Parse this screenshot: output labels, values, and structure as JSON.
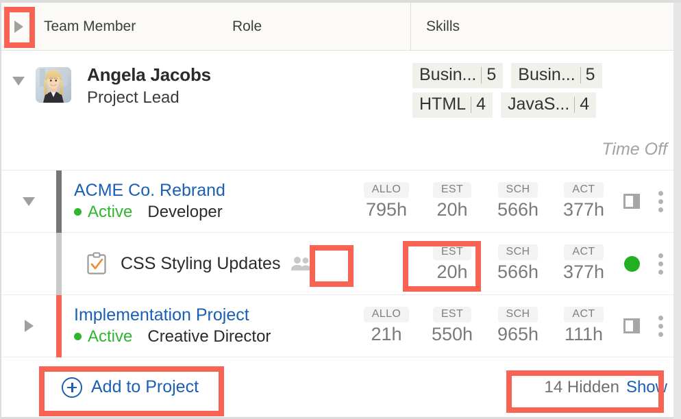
{
  "header": {
    "expand_icon": "caret-right-icon",
    "columns": [
      {
        "label": "Team Member"
      },
      {
        "label": "Role"
      },
      {
        "label": "Skills"
      }
    ]
  },
  "member": {
    "collapse_icon": "caret-down-icon",
    "avatar_alt": "Angela Jacobs avatar",
    "name": "Angela Jacobs",
    "role": "Project Lead",
    "skills": [
      {
        "name": "Busin...",
        "level": "5"
      },
      {
        "name": "Busin...",
        "level": "5"
      },
      {
        "name": "HTML",
        "level": "4"
      },
      {
        "name": "JavaS...",
        "level": "4"
      }
    ],
    "time_off_label": "Time Off"
  },
  "rows": [
    {
      "kind": "project",
      "caret": "caret-down-icon",
      "bar_color": "#767676",
      "title": "ACME Co. Rebrand",
      "status": "Active",
      "role": "Developer",
      "metrics": [
        {
          "label": "ALLO",
          "value": "795h"
        },
        {
          "label": "EST",
          "value": "20h"
        },
        {
          "label": "SCH",
          "value": "566h"
        },
        {
          "label": "ACT",
          "value": "377h"
        }
      ],
      "trailing_icon": "panel-split-icon",
      "menu_icon": "kebab-menu-icon"
    },
    {
      "kind": "task",
      "bar_color": "#c9c9c9",
      "task_icon": "clipboard-check-icon",
      "title": "CSS Styling Updates",
      "people_icon": "people-icon",
      "metrics": [
        {
          "label": "EST",
          "value": "20h"
        },
        {
          "label": "SCH",
          "value": "566h"
        },
        {
          "label": "ACT",
          "value": "377h"
        }
      ],
      "trailing_icon": "green-status-dot",
      "menu_icon": "kebab-menu-icon"
    },
    {
      "kind": "project",
      "caret": "caret-right-icon",
      "bar_color": "#f96353",
      "title": "Implementation Project",
      "status": "Active",
      "role": "Creative Director",
      "metrics": [
        {
          "label": "ALLO",
          "value": "21h"
        },
        {
          "label": "EST",
          "value": "550h"
        },
        {
          "label": "SCH",
          "value": "965h"
        },
        {
          "label": "ACT",
          "value": "111h"
        }
      ],
      "trailing_icon": "panel-split-icon",
      "menu_icon": "kebab-menu-icon"
    }
  ],
  "footer": {
    "add_icon": "plus-circle-icon",
    "add_label": "Add to Project",
    "hidden_count_label": "14 Hidden",
    "show_label": "Show"
  },
  "colors": {
    "accent_red": "#f96353",
    "link_blue": "#1a5fb4",
    "status_green": "#2fb52f",
    "header_bg": "#fbfaf6",
    "muted_text": "#7a7a7a"
  }
}
